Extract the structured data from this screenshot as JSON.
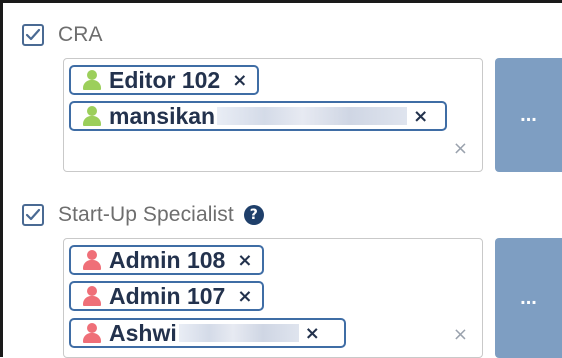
{
  "roles": [
    {
      "title": "CRA",
      "checked": true,
      "has_help": false,
      "users": [
        {
          "name": "Editor 102",
          "color": "green",
          "redacted": false
        },
        {
          "name": "mansikan",
          "color": "green",
          "redacted": true
        }
      ],
      "clear_symbol": "×",
      "more_label": "..."
    },
    {
      "title": "Start-Up Specialist",
      "checked": true,
      "has_help": true,
      "help_symbol": "?",
      "users": [
        {
          "name": "Admin 108",
          "color": "red",
          "redacted": false
        },
        {
          "name": "Admin 107",
          "color": "red",
          "redacted": false
        },
        {
          "name": "Ashwi",
          "color": "red",
          "redacted": true
        }
      ],
      "clear_symbol": "×",
      "more_label": "..."
    }
  ],
  "tag_remove_symbol": "×",
  "colors": {
    "tag_border": "#3f6da5",
    "tag_text": "#23324d",
    "user_green": "#9ccf5b",
    "user_red": "#ef6f78",
    "more_button": "#7e9ec2",
    "checkbox_border": "#4a6a93",
    "help_icon": "#1f3f6a"
  }
}
